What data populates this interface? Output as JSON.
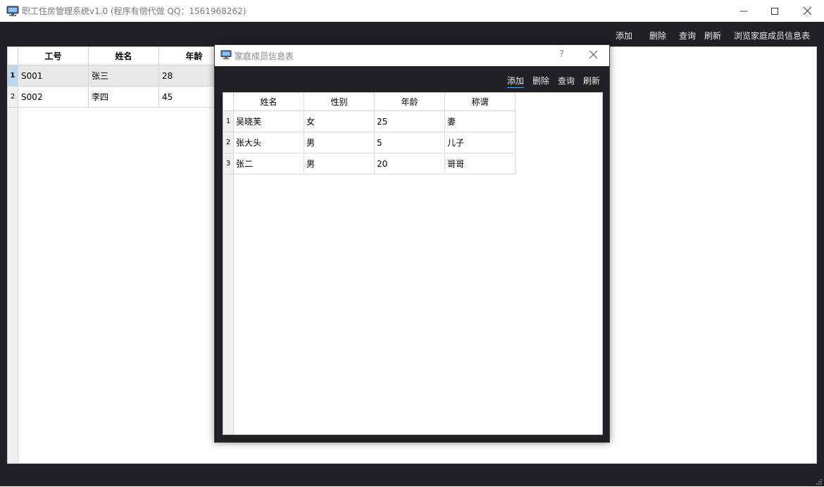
{
  "window": {
    "title": "职工住房管理系统v1.0 (程序有偿代做 QQ：1561968262)",
    "icon": "monitor-icon",
    "controls": [
      "minimize-icon",
      "maximize-icon",
      "close-icon"
    ]
  },
  "toolbar": {
    "add": "添加",
    "delete": "删除",
    "query": "查询",
    "refresh": "刷新",
    "browse_family": "浏览家庭成员信息表"
  },
  "main_table": {
    "columns": [
      "工号",
      "姓名",
      "年龄"
    ],
    "rows": [
      {
        "num": "1",
        "cells": [
          "S001",
          "张三",
          "28"
        ]
      },
      {
        "num": "2",
        "cells": [
          "S002",
          "李四",
          "45"
        ]
      }
    ],
    "selected_row": "1"
  },
  "dialog": {
    "title": "家庭成员信息表",
    "help": "?",
    "toolbar": {
      "add": "添加",
      "delete": "删除",
      "query": "查询",
      "refresh": "刷新"
    },
    "table": {
      "columns": [
        "姓名",
        "性别",
        "年龄",
        "称谓"
      ],
      "rows": [
        {
          "num": "1",
          "cells": [
            "吴晓芙",
            "女",
            "25",
            "妻"
          ]
        },
        {
          "num": "2",
          "cells": [
            "张大头",
            "男",
            "5",
            "儿子"
          ]
        },
        {
          "num": "3",
          "cells": [
            "张二",
            "男",
            "20",
            "哥哥"
          ]
        }
      ]
    }
  },
  "colors": {
    "dark_background": "#212125",
    "toolbar_text": "#e8e8e8",
    "selected_row": "#e8e8e8",
    "selected_header": "#bcd8ee",
    "focus_underline": "#4aa3df"
  }
}
